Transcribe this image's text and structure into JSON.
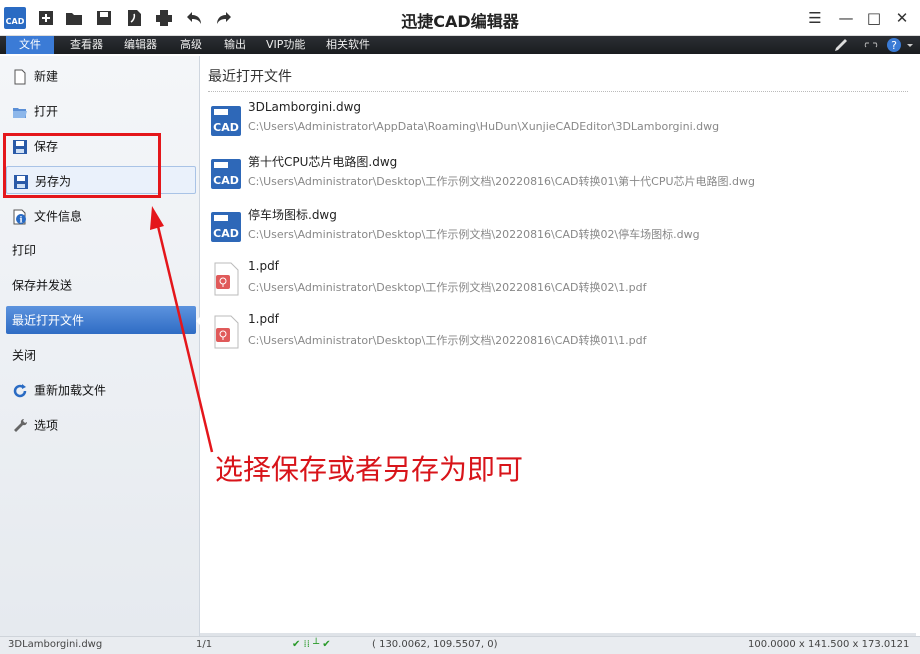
{
  "window": {
    "title": "迅捷CAD编辑器",
    "app_icon_text": "CAD"
  },
  "quick_access": [
    "new-icon",
    "open-folder-icon",
    "save-icon",
    "pdf-icon",
    "print-icon",
    "undo-icon",
    "redo-icon"
  ],
  "menu": {
    "items": [
      {
        "label": "文件",
        "active": true
      },
      {
        "label": "查看器"
      },
      {
        "label": "编辑器"
      },
      {
        "label": "高级"
      },
      {
        "label": "输出"
      },
      {
        "label": "VIP功能"
      },
      {
        "label": "相关软件"
      }
    ]
  },
  "nav": {
    "items": [
      {
        "label": "新建",
        "icon": "new-file-icon"
      },
      {
        "label": "打开",
        "icon": "open-folder-icon"
      },
      {
        "label": "保存",
        "icon": "save-icon"
      },
      {
        "label": "另存为",
        "icon": "save-as-icon"
      },
      {
        "label": "文件信息",
        "icon": "info-icon"
      },
      {
        "label": "打印"
      },
      {
        "label": "保存并发送"
      },
      {
        "label": "最近打开文件",
        "active": true
      },
      {
        "label": "关闭"
      },
      {
        "label": "重新加载文件",
        "icon": "reload-icon"
      },
      {
        "label": "选项",
        "icon": "wrench-icon"
      }
    ]
  },
  "recent": {
    "title": "最近打开文件",
    "files": [
      {
        "name": "3DLamborgini.dwg",
        "path": "C:\\Users\\Administrator\\AppData\\Roaming\\HuDun\\XunjieCADEditor\\3DLamborgini.dwg",
        "type": "cad"
      },
      {
        "name": "第十代CPU芯片电路图.dwg",
        "path": "C:\\Users\\Administrator\\Desktop\\工作示例文档\\20220816\\CAD转换01\\第十代CPU芯片电路图.dwg",
        "type": "cad"
      },
      {
        "name": "停车场图标.dwg",
        "path": "C:\\Users\\Administrator\\Desktop\\工作示例文档\\20220816\\CAD转换02\\停车场图标.dwg",
        "type": "cad"
      },
      {
        "name": "1.pdf",
        "path": "C:\\Users\\Administrator\\Desktop\\工作示例文档\\20220816\\CAD转换02\\1.pdf",
        "type": "pdf"
      },
      {
        "name": "1.pdf",
        "path": "C:\\Users\\Administrator\\Desktop\\工作示例文档\\20220816\\CAD转换01\\1.pdf",
        "type": "pdf"
      }
    ]
  },
  "status": {
    "file": "3DLamborgini.dwg",
    "page": "1/1",
    "coords": "( 130.0062, 109.5507, 0)",
    "dimensions": "100.0000 x 141.500 x 173.0121"
  },
  "annotation": {
    "text": "选择保存或者另存为即可",
    "color": "#d8141a"
  },
  "colors": {
    "accent": "#3b7bd6",
    "annotation_red": "#e4161b"
  }
}
